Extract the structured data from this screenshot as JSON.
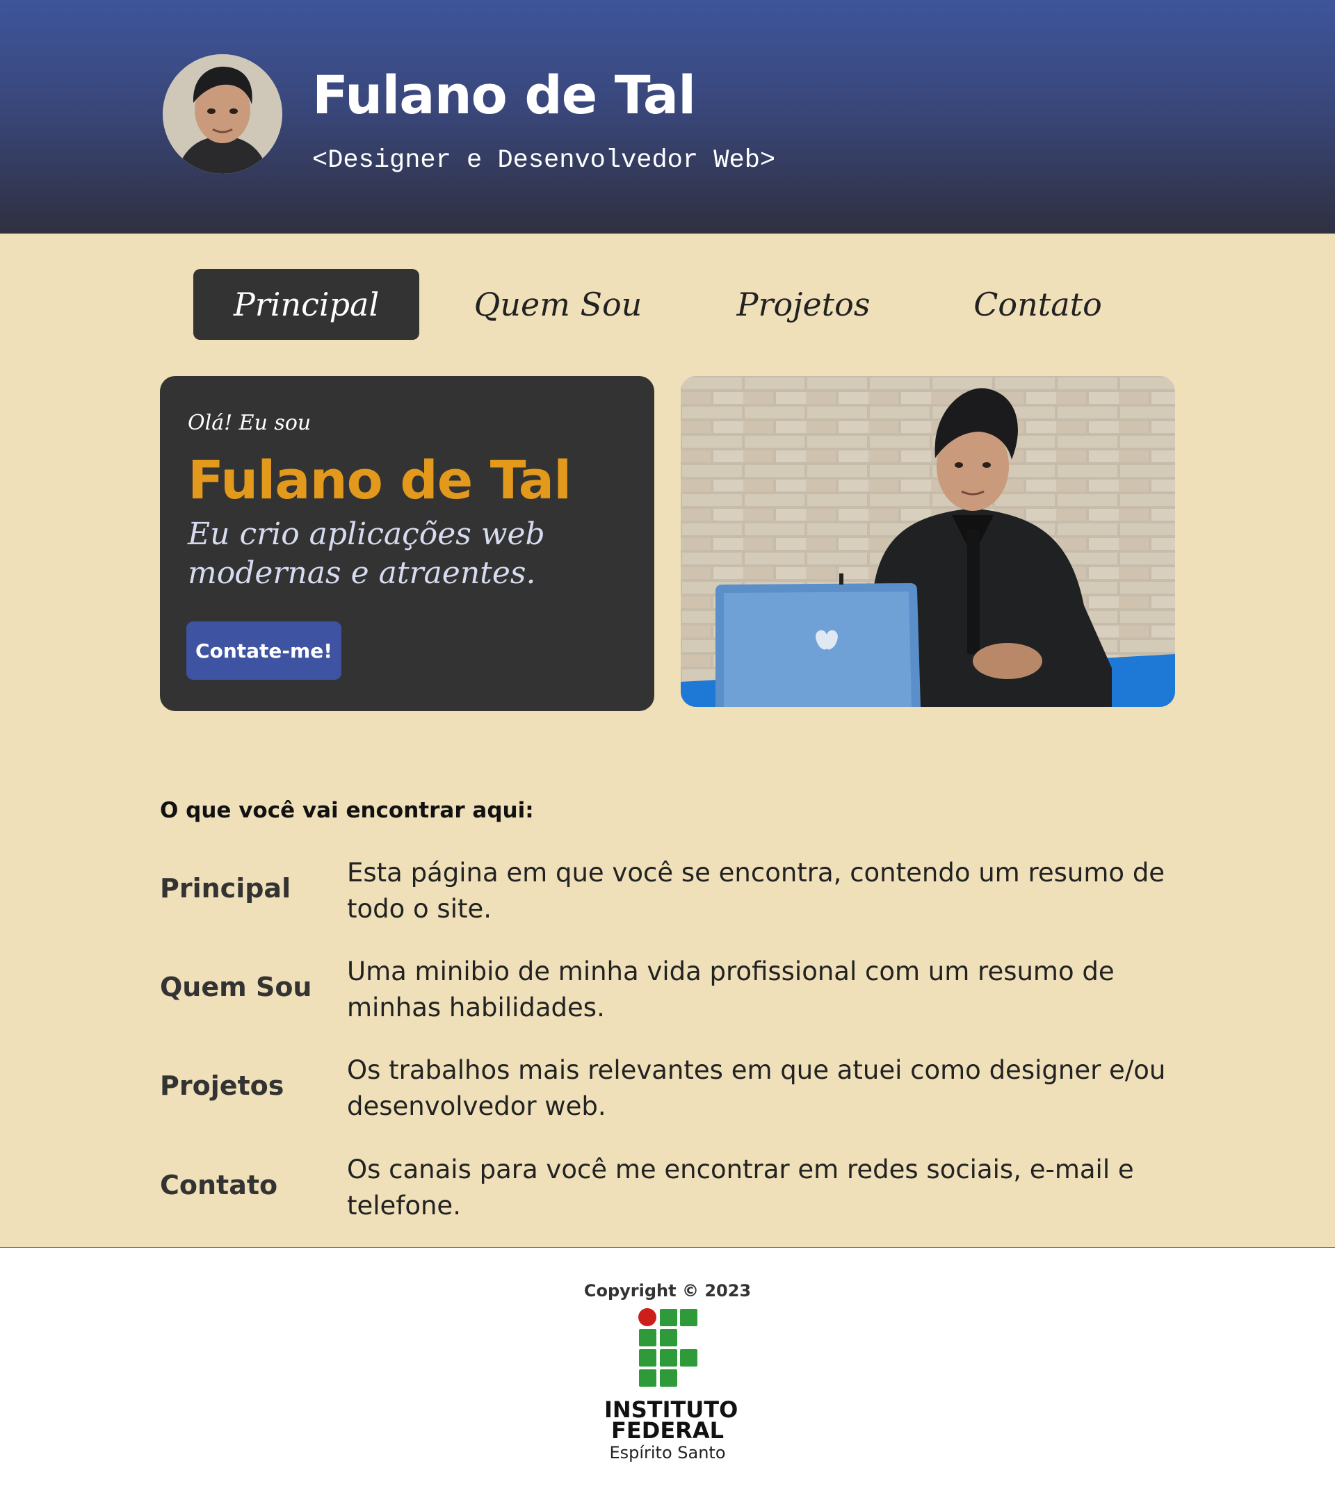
{
  "header": {
    "title": "Fulano de Tal",
    "subtitle": "<Designer e Desenvolvedor Web>"
  },
  "nav": {
    "items": [
      {
        "label": "Principal",
        "active": true
      },
      {
        "label": "Quem Sou",
        "active": false
      },
      {
        "label": "Projetos",
        "active": false
      },
      {
        "label": "Contato",
        "active": false
      }
    ]
  },
  "hero": {
    "greeting": "Olá! Eu sou",
    "name": "Fulano de Tal",
    "tagline": "Eu crio aplicações web modernas e atraentes.",
    "button_label": "Contate-me!"
  },
  "features": {
    "heading": "O que você vai encontrar aqui:",
    "items": [
      {
        "term": "Principal",
        "description": "Esta página em que você se encontra, contendo um resumo de todo o site."
      },
      {
        "term": "Quem Sou",
        "description": "Uma minibio de minha vida profissional com um resumo de minhas habilidades."
      },
      {
        "term": "Projetos",
        "description": "Os trabalhos mais relevantes em que atuei como designer e/ou desenvolvedor web."
      },
      {
        "term": "Contato",
        "description": "Os canais para você me encontrar em redes sociais, e-mail e telefone."
      }
    ]
  },
  "footer": {
    "copyright": "Copyright © 2023",
    "logo": {
      "line1": "INSTITUTO",
      "line2": "FEDERAL",
      "line3": "Espírito Santo"
    }
  },
  "colors": {
    "header_top": "#3e559b",
    "header_bottom": "#2f3040",
    "page_background": "#efe0b9",
    "card_background": "#333333",
    "accent_orange": "#e39a1c",
    "button_blue": "#3e53a2",
    "logo_green": "#2e9a3a",
    "logo_red": "#cc1f1a"
  }
}
